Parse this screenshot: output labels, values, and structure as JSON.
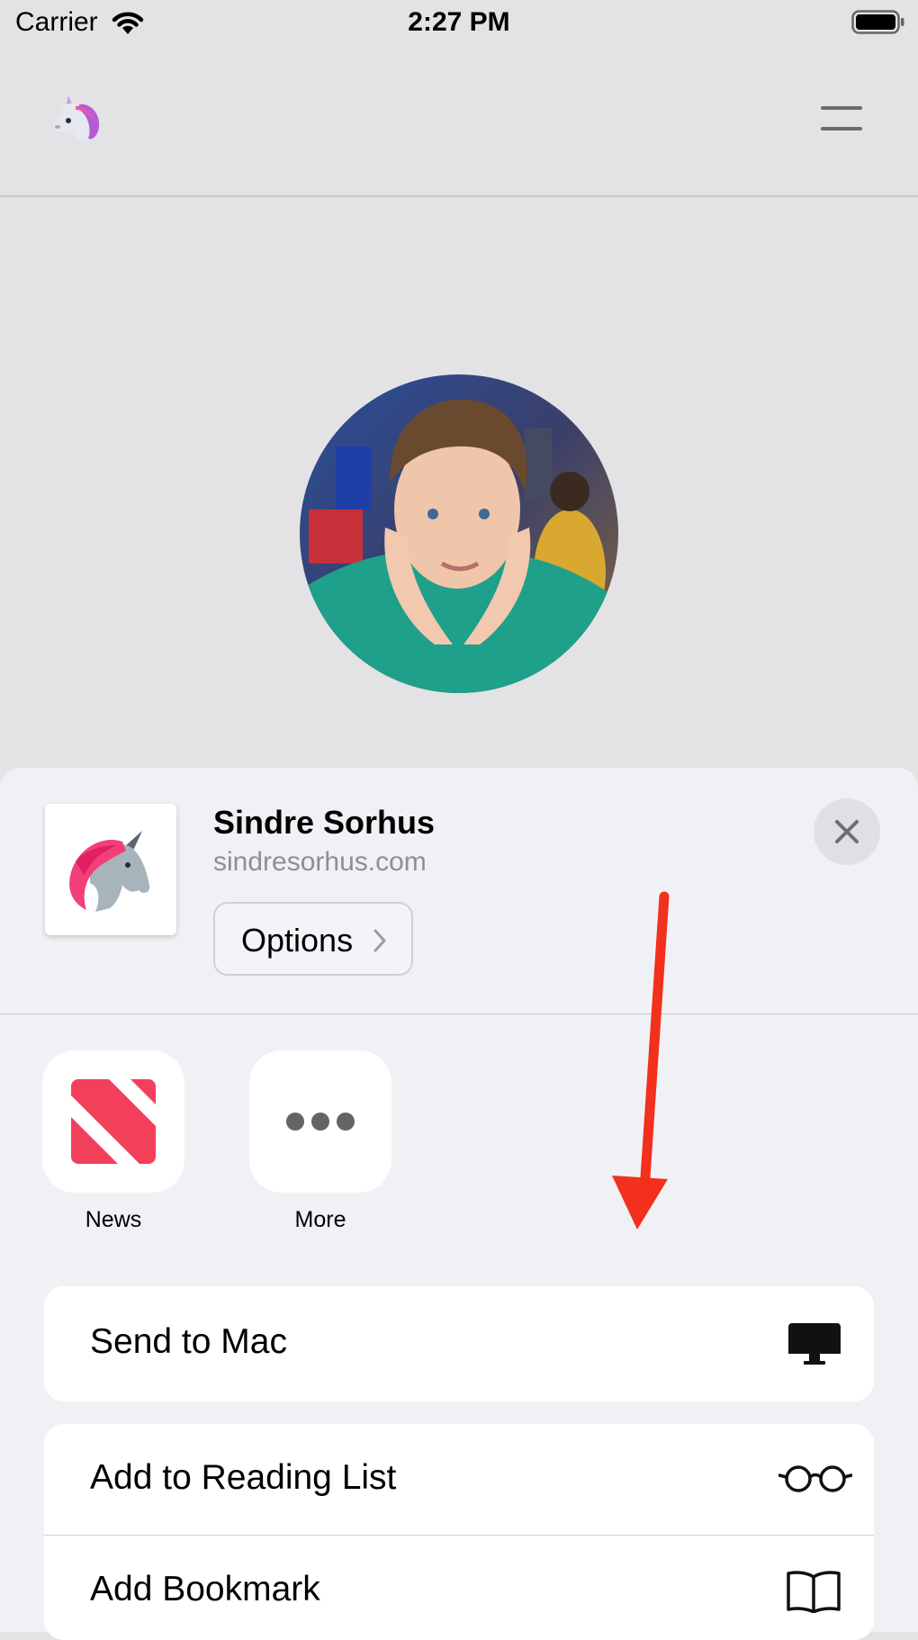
{
  "status_bar": {
    "carrier": "Carrier",
    "time": "2:27 PM",
    "icons": [
      "wifi-icon",
      "battery-icon"
    ]
  },
  "nav": {
    "logo_icon": "unicorn-logo-icon",
    "menu_icon": "hamburger-menu-icon"
  },
  "profile": {
    "avatar": "profile-photo"
  },
  "share_sheet": {
    "title": "Sindre Sorhus",
    "url": "sindresorhus.com",
    "options_label": "Options",
    "close_icon": "close-icon",
    "apps": [
      {
        "label": "News",
        "icon": "news-icon"
      },
      {
        "label": "More",
        "icon": "more-dots-icon"
      }
    ],
    "actions": [
      {
        "label": "Send to Mac",
        "icon": "desktop-computer-icon"
      },
      {
        "label": "Add to Reading List",
        "icon": "glasses-icon"
      },
      {
        "label": "Add Bookmark",
        "icon": "open-book-icon"
      }
    ],
    "annotation_color": "#f2301c"
  },
  "colors": {
    "background": "#e3e3e5",
    "sheet": "#f0f1f5",
    "secondary_text": "#8e8e93",
    "news_red": "#f23f5a"
  }
}
